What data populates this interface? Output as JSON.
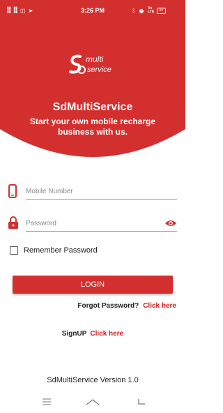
{
  "colors": {
    "primary": "#d32f2f",
    "link": "#cc1a1a"
  },
  "status_bar": {
    "left_icons": [
      "signal-icon",
      "signal-icon",
      "sim-icon",
      "telegram-icon"
    ],
    "time": "3:26 PM",
    "right_icons": [
      "bluetooth-icon",
      "alarm-icon",
      "volte-icon"
    ],
    "battery": "97"
  },
  "logo": {
    "multi": "multi",
    "service": "service"
  },
  "hero": {
    "title": "SdMultiService",
    "tagline": "Start your own mobile recharge business with us."
  },
  "form": {
    "mobile": {
      "placeholder": "Mobile Number",
      "value": ""
    },
    "password": {
      "placeholder": "Password",
      "value": ""
    },
    "remember_label": "Remember Password",
    "login_label": "LOGIN",
    "forgot_text": "Forgot Password?",
    "forgot_link": "Click here",
    "signup_text": "SignUP",
    "signup_link": "Click here"
  },
  "footer": {
    "version": "SdMultiService Version 1.0"
  },
  "nav": {
    "icons": [
      "menu-icon",
      "home-icon",
      "back-icon"
    ]
  }
}
